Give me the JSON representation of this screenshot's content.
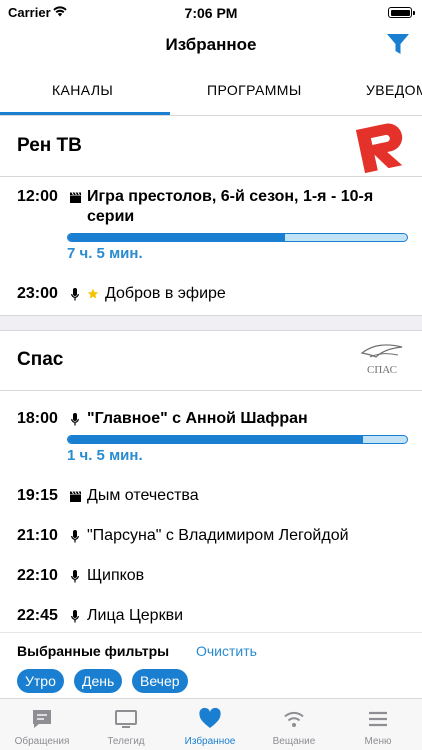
{
  "status_bar": {
    "carrier": "Carrier",
    "time": "7:06 PM"
  },
  "nav": {
    "title": "Избранное",
    "filter_icon": "filter-icon"
  },
  "tabs": [
    {
      "label": "КАНАЛЫ",
      "active": true
    },
    {
      "label": "ПРОГРАММЫ",
      "active": false
    },
    {
      "label": "УВЕДОМ",
      "active": false
    }
  ],
  "channels": [
    {
      "name": "Рен ТВ",
      "logo": "ren-tv-logo",
      "programs": [
        {
          "time": "12:00",
          "icon": "clapperboard-icon",
          "title": "Игра престолов, 6-й сезон, 1-я - 10-я серии",
          "bold": true,
          "progress": 0.64,
          "duration": "7 ч. 5 мин."
        },
        {
          "time": "23:00",
          "icon": "microphone-icon",
          "star": true,
          "title": "Добров в эфире",
          "bold": false
        }
      ]
    },
    {
      "name": "Спас",
      "logo": "spas-logo",
      "logo_text": "СПАС",
      "programs": [
        {
          "time": "18:00",
          "icon": "microphone-icon",
          "title": "\"Главное\" с Анной Шафран",
          "bold": true,
          "progress": 0.87,
          "duration": "1 ч. 5 мин."
        },
        {
          "time": "19:15",
          "icon": "clapperboard-icon",
          "title": "Дым отечества",
          "bold": false
        },
        {
          "time": "21:10",
          "icon": "microphone-icon",
          "title": "\"Парсуна\" с Владимиром Легойдой",
          "bold": false
        },
        {
          "time": "22:10",
          "icon": "microphone-icon",
          "title": "Щипков",
          "bold": false
        },
        {
          "time": "22:45",
          "icon": "microphone-icon",
          "title": "Лица Церкви",
          "bold": false
        }
      ]
    }
  ],
  "filters": {
    "title": "Выбранные фильтры",
    "clear_label": "Очистить",
    "chips": [
      "Утро",
      "День",
      "Вечер"
    ]
  },
  "tabbar": [
    {
      "label": "Обращения",
      "icon": "chat-icon",
      "active": false
    },
    {
      "label": "Телегид",
      "icon": "tv-icon",
      "active": false
    },
    {
      "label": "Избранное",
      "icon": "heart-icon",
      "active": true
    },
    {
      "label": "Вещание",
      "icon": "broadcast-icon",
      "active": false
    },
    {
      "label": "Меню",
      "icon": "menu-icon",
      "active": false
    }
  ],
  "colors": {
    "accent": "#1a7fd0",
    "accent_light": "#c2e3f5",
    "link": "#2a8ccf",
    "inactive": "#8e8e93",
    "logo_red": "#e4322b"
  }
}
